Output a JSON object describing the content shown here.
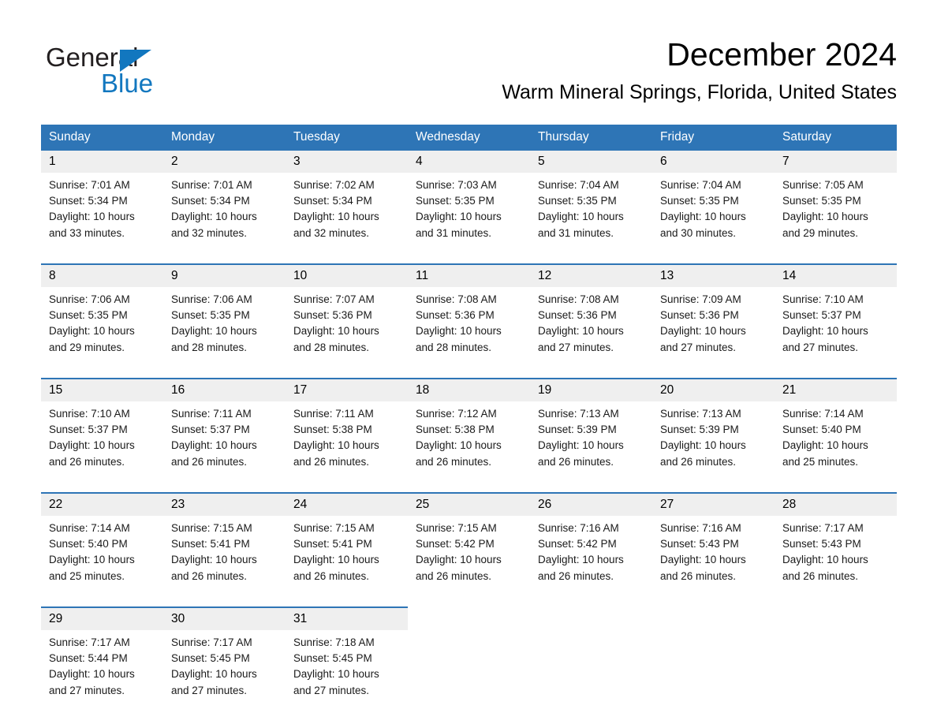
{
  "brand": {
    "name_part1": "General",
    "name_part2": "Blue",
    "logo_icon": "blue-triangle",
    "color_black": "#231f20",
    "color_blue": "#1277bf"
  },
  "header": {
    "title": "December 2024",
    "subtitle": "Warm Mineral Springs, Florida, United States"
  },
  "theme": {
    "header_bg": "#2e75b6",
    "header_text": "#ffffff",
    "date_cell_bg": "#efefef",
    "body_bg": "#ffffff",
    "separator": "#2e75b6"
  },
  "weekdays": [
    "Sunday",
    "Monday",
    "Tuesday",
    "Wednesday",
    "Thursday",
    "Friday",
    "Saturday"
  ],
  "weeks": [
    {
      "days": [
        {
          "num": "1",
          "sunrise": "Sunrise: 7:01 AM",
          "sunset": "Sunset: 5:34 PM",
          "daylight1": "Daylight: 10 hours",
          "daylight2": "and 33 minutes."
        },
        {
          "num": "2",
          "sunrise": "Sunrise: 7:01 AM",
          "sunset": "Sunset: 5:34 PM",
          "daylight1": "Daylight: 10 hours",
          "daylight2": "and 32 minutes."
        },
        {
          "num": "3",
          "sunrise": "Sunrise: 7:02 AM",
          "sunset": "Sunset: 5:34 PM",
          "daylight1": "Daylight: 10 hours",
          "daylight2": "and 32 minutes."
        },
        {
          "num": "4",
          "sunrise": "Sunrise: 7:03 AM",
          "sunset": "Sunset: 5:35 PM",
          "daylight1": "Daylight: 10 hours",
          "daylight2": "and 31 minutes."
        },
        {
          "num": "5",
          "sunrise": "Sunrise: 7:04 AM",
          "sunset": "Sunset: 5:35 PM",
          "daylight1": "Daylight: 10 hours",
          "daylight2": "and 31 minutes."
        },
        {
          "num": "6",
          "sunrise": "Sunrise: 7:04 AM",
          "sunset": "Sunset: 5:35 PM",
          "daylight1": "Daylight: 10 hours",
          "daylight2": "and 30 minutes."
        },
        {
          "num": "7",
          "sunrise": "Sunrise: 7:05 AM",
          "sunset": "Sunset: 5:35 PM",
          "daylight1": "Daylight: 10 hours",
          "daylight2": "and 29 minutes."
        }
      ]
    },
    {
      "days": [
        {
          "num": "8",
          "sunrise": "Sunrise: 7:06 AM",
          "sunset": "Sunset: 5:35 PM",
          "daylight1": "Daylight: 10 hours",
          "daylight2": "and 29 minutes."
        },
        {
          "num": "9",
          "sunrise": "Sunrise: 7:06 AM",
          "sunset": "Sunset: 5:35 PM",
          "daylight1": "Daylight: 10 hours",
          "daylight2": "and 28 minutes."
        },
        {
          "num": "10",
          "sunrise": "Sunrise: 7:07 AM",
          "sunset": "Sunset: 5:36 PM",
          "daylight1": "Daylight: 10 hours",
          "daylight2": "and 28 minutes."
        },
        {
          "num": "11",
          "sunrise": "Sunrise: 7:08 AM",
          "sunset": "Sunset: 5:36 PM",
          "daylight1": "Daylight: 10 hours",
          "daylight2": "and 28 minutes."
        },
        {
          "num": "12",
          "sunrise": "Sunrise: 7:08 AM",
          "sunset": "Sunset: 5:36 PM",
          "daylight1": "Daylight: 10 hours",
          "daylight2": "and 27 minutes."
        },
        {
          "num": "13",
          "sunrise": "Sunrise: 7:09 AM",
          "sunset": "Sunset: 5:36 PM",
          "daylight1": "Daylight: 10 hours",
          "daylight2": "and 27 minutes."
        },
        {
          "num": "14",
          "sunrise": "Sunrise: 7:10 AM",
          "sunset": "Sunset: 5:37 PM",
          "daylight1": "Daylight: 10 hours",
          "daylight2": "and 27 minutes."
        }
      ]
    },
    {
      "days": [
        {
          "num": "15",
          "sunrise": "Sunrise: 7:10 AM",
          "sunset": "Sunset: 5:37 PM",
          "daylight1": "Daylight: 10 hours",
          "daylight2": "and 26 minutes."
        },
        {
          "num": "16",
          "sunrise": "Sunrise: 7:11 AM",
          "sunset": "Sunset: 5:37 PM",
          "daylight1": "Daylight: 10 hours",
          "daylight2": "and 26 minutes."
        },
        {
          "num": "17",
          "sunrise": "Sunrise: 7:11 AM",
          "sunset": "Sunset: 5:38 PM",
          "daylight1": "Daylight: 10 hours",
          "daylight2": "and 26 minutes."
        },
        {
          "num": "18",
          "sunrise": "Sunrise: 7:12 AM",
          "sunset": "Sunset: 5:38 PM",
          "daylight1": "Daylight: 10 hours",
          "daylight2": "and 26 minutes."
        },
        {
          "num": "19",
          "sunrise": "Sunrise: 7:13 AM",
          "sunset": "Sunset: 5:39 PM",
          "daylight1": "Daylight: 10 hours",
          "daylight2": "and 26 minutes."
        },
        {
          "num": "20",
          "sunrise": "Sunrise: 7:13 AM",
          "sunset": "Sunset: 5:39 PM",
          "daylight1": "Daylight: 10 hours",
          "daylight2": "and 26 minutes."
        },
        {
          "num": "21",
          "sunrise": "Sunrise: 7:14 AM",
          "sunset": "Sunset: 5:40 PM",
          "daylight1": "Daylight: 10 hours",
          "daylight2": "and 25 minutes."
        }
      ]
    },
    {
      "days": [
        {
          "num": "22",
          "sunrise": "Sunrise: 7:14 AM",
          "sunset": "Sunset: 5:40 PM",
          "daylight1": "Daylight: 10 hours",
          "daylight2": "and 25 minutes."
        },
        {
          "num": "23",
          "sunrise": "Sunrise: 7:15 AM",
          "sunset": "Sunset: 5:41 PM",
          "daylight1": "Daylight: 10 hours",
          "daylight2": "and 26 minutes."
        },
        {
          "num": "24",
          "sunrise": "Sunrise: 7:15 AM",
          "sunset": "Sunset: 5:41 PM",
          "daylight1": "Daylight: 10 hours",
          "daylight2": "and 26 minutes."
        },
        {
          "num": "25",
          "sunrise": "Sunrise: 7:15 AM",
          "sunset": "Sunset: 5:42 PM",
          "daylight1": "Daylight: 10 hours",
          "daylight2": "and 26 minutes."
        },
        {
          "num": "26",
          "sunrise": "Sunrise: 7:16 AM",
          "sunset": "Sunset: 5:42 PM",
          "daylight1": "Daylight: 10 hours",
          "daylight2": "and 26 minutes."
        },
        {
          "num": "27",
          "sunrise": "Sunrise: 7:16 AM",
          "sunset": "Sunset: 5:43 PM",
          "daylight1": "Daylight: 10 hours",
          "daylight2": "and 26 minutes."
        },
        {
          "num": "28",
          "sunrise": "Sunrise: 7:17 AM",
          "sunset": "Sunset: 5:43 PM",
          "daylight1": "Daylight: 10 hours",
          "daylight2": "and 26 minutes."
        }
      ]
    },
    {
      "days": [
        {
          "num": "29",
          "sunrise": "Sunrise: 7:17 AM",
          "sunset": "Sunset: 5:44 PM",
          "daylight1": "Daylight: 10 hours",
          "daylight2": "and 27 minutes."
        },
        {
          "num": "30",
          "sunrise": "Sunrise: 7:17 AM",
          "sunset": "Sunset: 5:45 PM",
          "daylight1": "Daylight: 10 hours",
          "daylight2": "and 27 minutes."
        },
        {
          "num": "31",
          "sunrise": "Sunrise: 7:18 AM",
          "sunset": "Sunset: 5:45 PM",
          "daylight1": "Daylight: 10 hours",
          "daylight2": "and 27 minutes."
        },
        {
          "num": "",
          "sunrise": "",
          "sunset": "",
          "daylight1": "",
          "daylight2": ""
        },
        {
          "num": "",
          "sunrise": "",
          "sunset": "",
          "daylight1": "",
          "daylight2": ""
        },
        {
          "num": "",
          "sunrise": "",
          "sunset": "",
          "daylight1": "",
          "daylight2": ""
        },
        {
          "num": "",
          "sunrise": "",
          "sunset": "",
          "daylight1": "",
          "daylight2": ""
        }
      ]
    }
  ]
}
